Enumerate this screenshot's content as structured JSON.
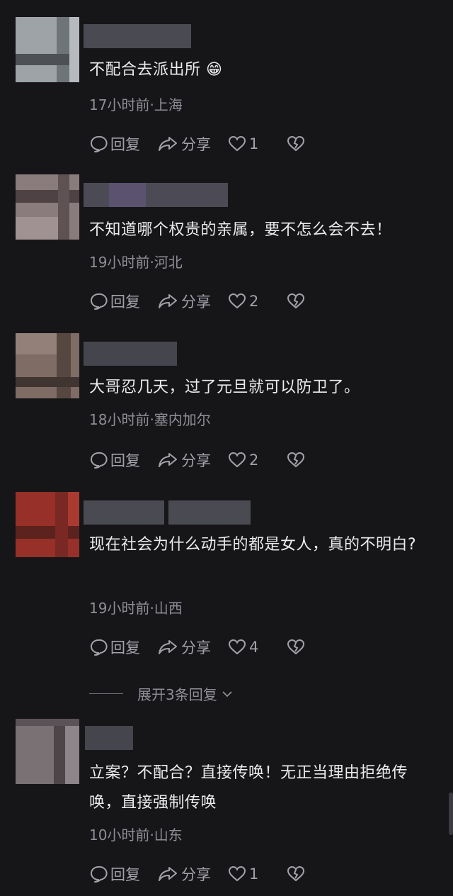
{
  "comments": [
    {
      "text": "不配合去派出所 😁",
      "meta": "17小时前·上海",
      "reply_label": "回复",
      "share_label": "分享",
      "likes": "1"
    },
    {
      "text": "不知道哪个权贵的亲属，要不怎么会不去！",
      "meta": "19小时前·河北",
      "reply_label": "回复",
      "share_label": "分享",
      "likes": "2"
    },
    {
      "text": "大哥忍几天，过了元旦就可以防卫了。",
      "meta": "18小时前·塞内加尔",
      "reply_label": "回复",
      "share_label": "分享",
      "likes": "2"
    },
    {
      "text": "现在社会为什么动手的都是女人，真的不明白?",
      "meta": "19小时前·山西",
      "reply_label": "回复",
      "share_label": "分享",
      "likes": "4"
    },
    {
      "text": "立案？不配合？直接传唤！无正当理由拒绝传唤，直接强制传唤",
      "meta": "10小时前·山东",
      "reply_label": "回复",
      "share_label": "分享",
      "likes": "1"
    }
  ],
  "expand_replies": "展开3条回复",
  "icons": {
    "reply": "comment-bubble-icon",
    "share": "share-arrow-icon",
    "like": "heart-icon",
    "dislike": "broken-heart-icon",
    "expand": "chevron-down-icon"
  },
  "colors": {
    "background": "#161619",
    "text": "#ececef",
    "meta": "#8e8e96",
    "action": "#a2a2aa"
  }
}
